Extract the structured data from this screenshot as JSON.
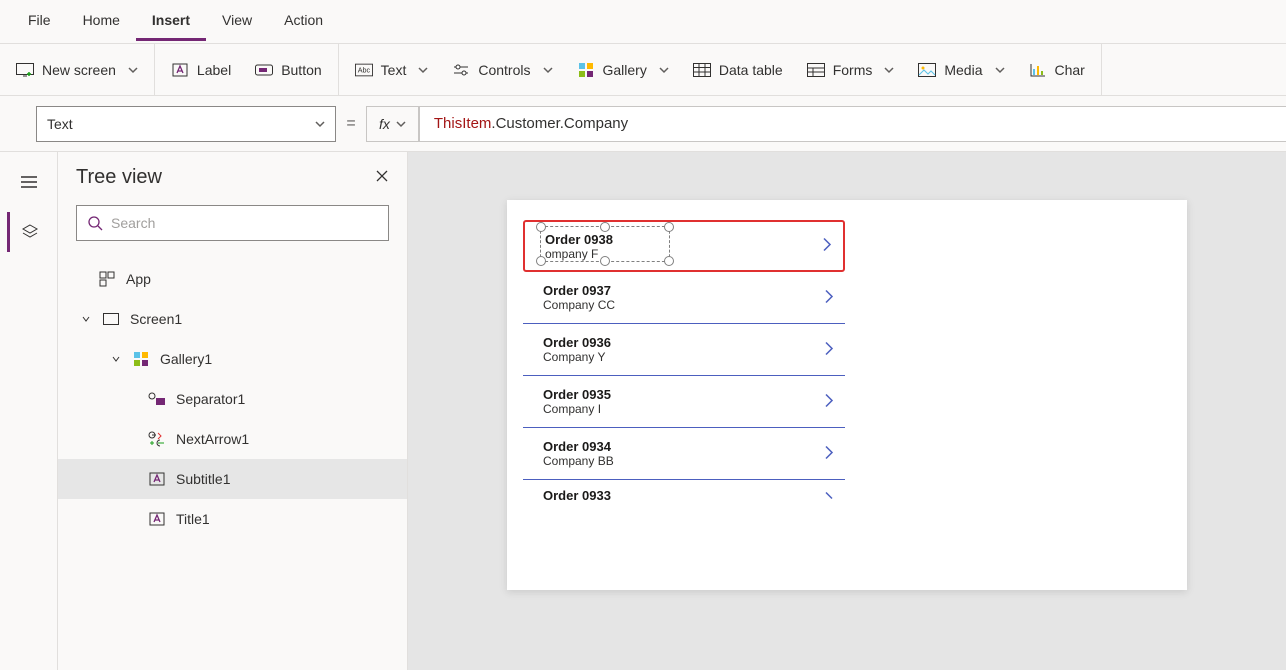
{
  "menu": {
    "items": [
      "File",
      "Home",
      "Insert",
      "View",
      "Action"
    ],
    "active": "Insert"
  },
  "ribbon": {
    "new_screen": "New screen",
    "label": "Label",
    "button": "Button",
    "text": "Text",
    "controls": "Controls",
    "gallery": "Gallery",
    "data_table": "Data table",
    "forms": "Forms",
    "media": "Media",
    "charts": "Char"
  },
  "property_selector": {
    "value": "Text"
  },
  "formula": {
    "this": "ThisItem",
    "rest": ".Customer.Company"
  },
  "tree": {
    "title": "Tree view",
    "search_placeholder": "Search",
    "app": "App",
    "screen": "Screen1",
    "gallery": "Gallery1",
    "separator": "Separator1",
    "nextarrow": "NextArrow1",
    "subtitle": "Subtitle1",
    "title_item": "Title1"
  },
  "gallery_items": [
    {
      "title": "Order 0938",
      "sub": "ompany F"
    },
    {
      "title": "Order 0937",
      "sub": "Company CC"
    },
    {
      "title": "Order 0936",
      "sub": "Company Y"
    },
    {
      "title": "Order 0935",
      "sub": "Company I"
    },
    {
      "title": "Order 0934",
      "sub": "Company BB"
    },
    {
      "title": "Order 0933",
      "sub": ""
    }
  ]
}
